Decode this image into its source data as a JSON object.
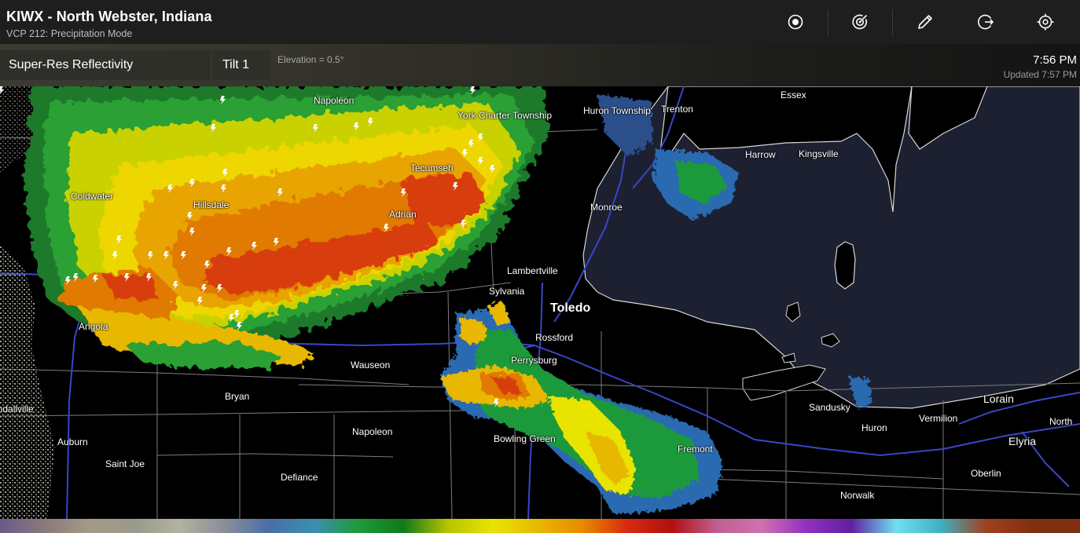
{
  "header": {
    "title": "KIWX - North Webster, Indiana",
    "subtitle": "VCP 212: Precipitation Mode"
  },
  "toolbar": {
    "buttons": [
      {
        "icon": "radar-site-icon"
      },
      {
        "icon": "radar-sweep-icon"
      },
      {
        "icon": "pencil-icon"
      },
      {
        "icon": "exit-circle-icon"
      },
      {
        "icon": "crosshair-icon"
      }
    ]
  },
  "subbar": {
    "product": "Super-Res Reflectivity",
    "tilt": "Tilt 1",
    "elevation": "Elevation = 0.5°",
    "time": "7:56 PM",
    "updated": "Updated 7:57 PM"
  },
  "map": {
    "cities": [
      {
        "name": "Napoleon",
        "size": "small"
      },
      {
        "name": "York Charter Township",
        "size": "small"
      },
      {
        "name": "Huron Township",
        "size": "small"
      },
      {
        "name": "Trenton",
        "size": "small"
      },
      {
        "name": "Essex",
        "size": "small"
      },
      {
        "name": "Harrow",
        "size": "small"
      },
      {
        "name": "Kingsville",
        "size": "small"
      },
      {
        "name": "Tecumseh",
        "size": "small"
      },
      {
        "name": "Coldwater",
        "size": "small"
      },
      {
        "name": "Hillsdale",
        "size": "small"
      },
      {
        "name": "Adrian",
        "size": "small"
      },
      {
        "name": "Monroe",
        "size": "small"
      },
      {
        "name": "Lambertville",
        "size": "small"
      },
      {
        "name": "Sylvania",
        "size": "small"
      },
      {
        "name": "Toledo",
        "size": "big"
      },
      {
        "name": "Rossford",
        "size": "small"
      },
      {
        "name": "Angola",
        "size": "small"
      },
      {
        "name": "Wauseon",
        "size": "small"
      },
      {
        "name": "Perrysburg",
        "size": "small"
      },
      {
        "name": "Bryan",
        "size": "small"
      },
      {
        "name": "Sandusky",
        "size": "small"
      },
      {
        "name": "Lorain",
        "size": "mid"
      },
      {
        "name": "Vermilion",
        "size": "small"
      },
      {
        "name": "Huron",
        "size": "small"
      },
      {
        "name": "North",
        "size": "small"
      },
      {
        "name": "Kendallville",
        "size": "small"
      },
      {
        "name": "Napoleon",
        "size": "small"
      },
      {
        "name": "Elyria",
        "size": "mid"
      },
      {
        "name": "Auburn",
        "size": "small"
      },
      {
        "name": "Bowling Green",
        "size": "small"
      },
      {
        "name": "Fremont",
        "size": "small"
      },
      {
        "name": "Saint Joe",
        "size": "small"
      },
      {
        "name": "Oberlin",
        "size": "small"
      },
      {
        "name": "Defiance",
        "size": "small"
      },
      {
        "name": "Norwalk",
        "size": "small"
      }
    ]
  },
  "legend": {
    "colors": [
      "#6a5a8a",
      "#8a7a7a",
      "#a59a86",
      "#9a9a8c",
      "#b3b2a0",
      "#8a8f98",
      "#4a6ea8",
      "#3a8fb0",
      "#1f9a3a",
      "#0f7a1a",
      "#b8c400",
      "#e8e400",
      "#e8b800",
      "#e88a00",
      "#d82a10",
      "#b01010",
      "#c06090",
      "#d070b0",
      "#9030c0",
      "#6020a0",
      "#70e0f0",
      "#40b0c0",
      "#a04020",
      "#803010"
    ]
  }
}
